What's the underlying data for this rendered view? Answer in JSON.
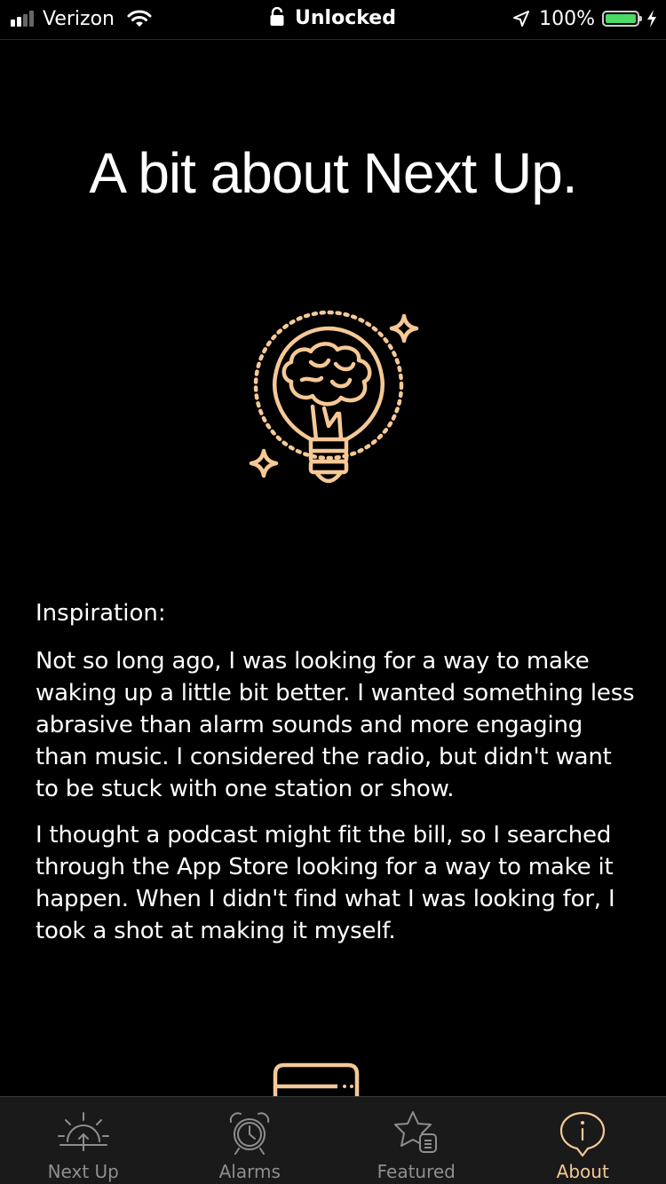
{
  "status_bar": {
    "carrier": "Verizon",
    "center_text": "Unlocked",
    "battery_percent": "100%",
    "battery_level": 1.0,
    "icons": [
      "signal-icon",
      "wifi-icon",
      "lock-icon",
      "location-icon",
      "battery-icon",
      "charging-icon"
    ]
  },
  "page": {
    "title": "A bit about Next Up."
  },
  "content": {
    "section_label": "Inspiration:",
    "paragraph_1": "Not so long ago, I was looking for a way to make waking up a little bit better. I wanted something less abrasive than alarm sounds and more engaging than music. I considered the radio, but didn't want to be stuck with one station or show.",
    "paragraph_2": "I thought a podcast might fit the bill, so I searched through the App Store looking for a way to make it happen. When I didn't find what I was looking for, I took a shot at making it myself.",
    "hero_icon": "lightbulb-brain-icon"
  },
  "tab_bar": {
    "tabs": [
      {
        "label": "Next Up",
        "icon": "sunrise-icon",
        "active": false
      },
      {
        "label": "Alarms",
        "icon": "alarm-clock-icon",
        "active": false
      },
      {
        "label": "Featured",
        "icon": "star-list-icon",
        "active": false
      },
      {
        "label": "About",
        "icon": "info-icon",
        "active": true
      }
    ]
  },
  "colors": {
    "accent": "#f5c896",
    "background": "#000000",
    "tab_bar_bg": "#1a1a1a",
    "inactive_tab": "#8e8e8e",
    "battery_fill": "#4cd964"
  }
}
